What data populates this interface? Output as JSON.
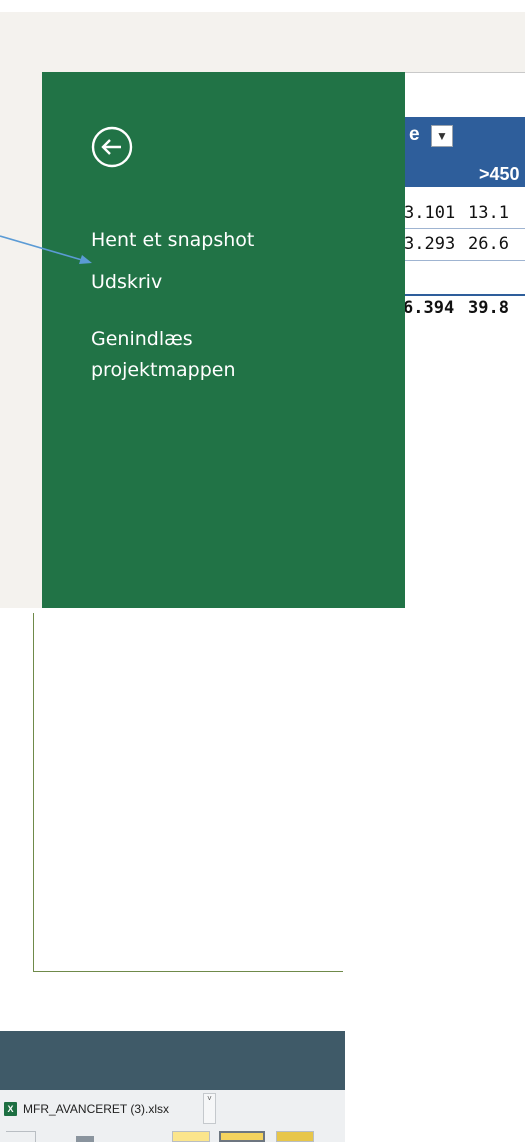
{
  "table": {
    "header_partial": "e",
    "filter_glyph": "▼",
    "column_header": ">450",
    "rows": [
      {
        "a": "3.101",
        "b": "13.1"
      },
      {
        "a": "3.293",
        "b": "26.6"
      }
    ],
    "total": {
      "a": "6.394",
      "b": "39.8"
    }
  },
  "backstage": {
    "back_glyph": "←",
    "menu": [
      "Hent et snapshot",
      "Udskriv",
      "Genindlæs projektmappen"
    ]
  },
  "download_bar": {
    "filename": "MFR_AVANCERET (3).xlsx",
    "caret": "˅"
  },
  "colors": {
    "panel_green": "#217346",
    "table_header_blue": "#2e5e9b",
    "arrow_blue": "#5b9bd5",
    "status_bar": "#3f5a68"
  }
}
